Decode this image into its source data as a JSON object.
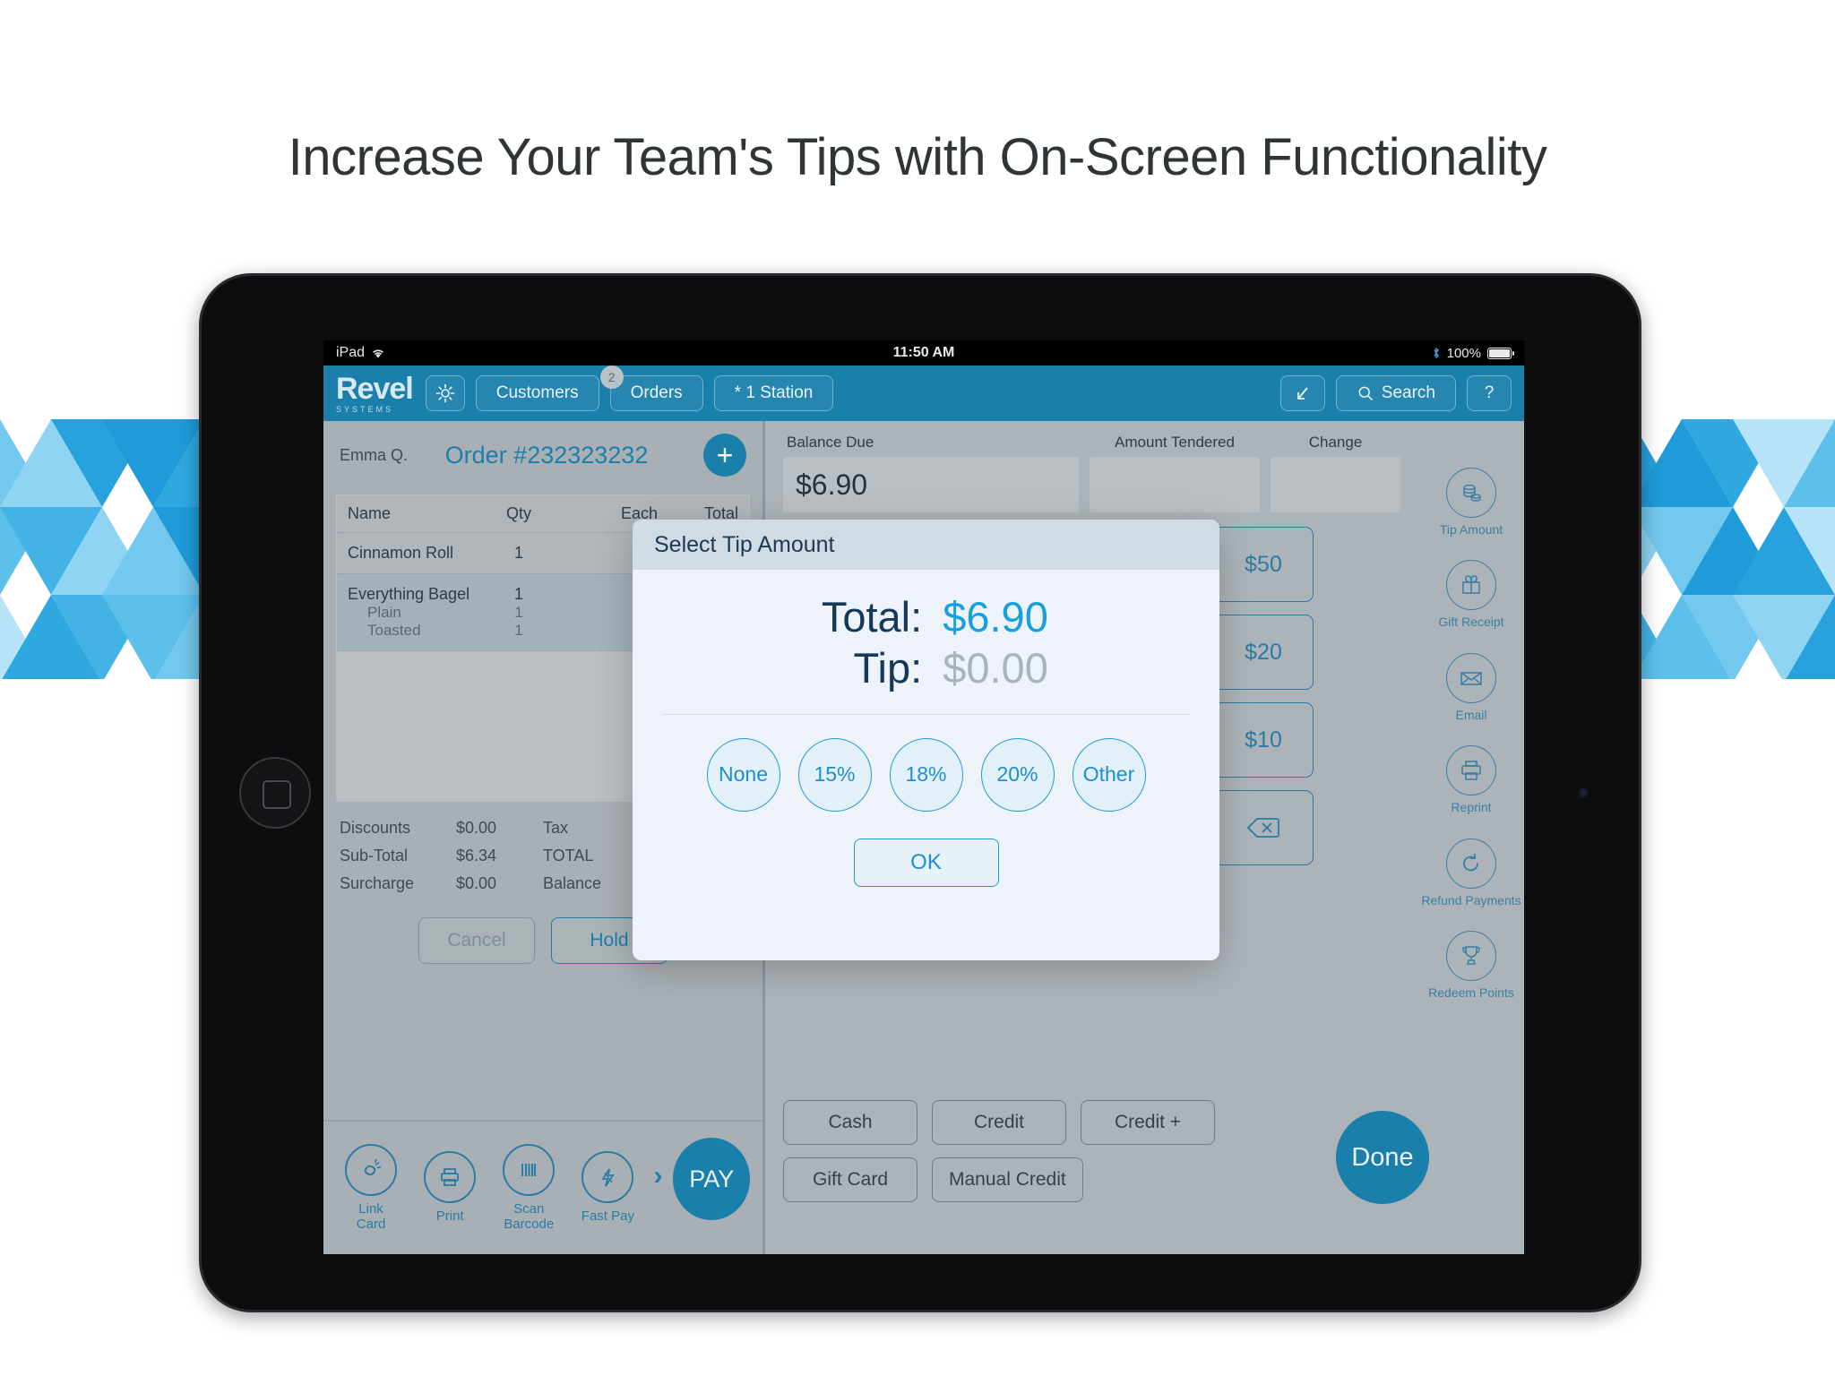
{
  "headline": "Increase Your Team's Tips with On-Screen Functionality",
  "status_bar": {
    "device": "iPad",
    "wifi_icon": "wifi-icon",
    "time": "11:50 AM",
    "bluetooth_icon": "bluetooth-icon",
    "battery_pct": "100%"
  },
  "toolbar": {
    "brand_name": "Revel",
    "brand_sub": "SYSTEMS",
    "settings_icon": "gear-icon",
    "customers_label": "Customers",
    "orders_label": "Orders",
    "orders_badge": "2",
    "station_label": "* 1 Station",
    "expand_icon": "expand-arrow-icon",
    "search_label": "Search",
    "search_icon": "search-icon",
    "help_label": "?"
  },
  "order": {
    "cashier": "Emma Q.",
    "order_number": "Order #232323232",
    "add_label": "+",
    "columns": [
      "Name",
      "Qty",
      "Each",
      "Total"
    ],
    "items": [
      {
        "name": "Cinnamon Roll",
        "qty": "1",
        "each": "",
        "total": ""
      },
      {
        "name": "Everything Bagel",
        "qty": "1",
        "each": "",
        "total": ""
      }
    ],
    "modifiers": [
      {
        "name": "Plain",
        "qty": "1"
      },
      {
        "name": "Toasted",
        "qty": "1"
      }
    ],
    "totals_left": [
      {
        "label": "Discounts",
        "value": "$0.00"
      },
      {
        "label": "Sub-Total",
        "value": "$6.34"
      },
      {
        "label": "Surcharge",
        "value": "$0.00"
      }
    ],
    "totals_right": [
      {
        "label": "Tax",
        "value": ""
      },
      {
        "label": "TOTAL",
        "value": ""
      },
      {
        "label": "Balance",
        "value": ""
      }
    ],
    "cancel_label": "Cancel",
    "hold_label": "Hold"
  },
  "quickbar": {
    "items": [
      {
        "icon": "link-card-icon",
        "label": "Link\nCard"
      },
      {
        "icon": "printer-icon",
        "label": "Print"
      },
      {
        "icon": "barcode-icon",
        "label": "Scan\nBarcode"
      },
      {
        "icon": "lightning-icon",
        "label": "Fast Pay"
      }
    ],
    "more_icon": "chevron-right-icon",
    "pay_label": "PAY"
  },
  "payment": {
    "balance_due_label": "Balance Due",
    "balance_due_value": "$6.90",
    "amount_tendered_label": "Amount Tendered",
    "amount_tendered_value": "",
    "change_label": "Change",
    "change_value": "",
    "denominations": [
      "$50",
      "$20",
      "$10"
    ],
    "backspace_icon": "backspace-icon",
    "methods_row1": [
      "Cash",
      "Credit",
      "Credit +"
    ],
    "methods_row2": [
      "Gift Card",
      "Manual Credit"
    ],
    "done_label": "Done"
  },
  "rail": {
    "items": [
      {
        "icon": "coins-icon",
        "label": "Tip Amount"
      },
      {
        "icon": "gift-icon",
        "label": "Gift Receipt"
      },
      {
        "icon": "envelope-icon",
        "label": "Email"
      },
      {
        "icon": "printer-icon",
        "label": "Reprint"
      },
      {
        "icon": "undo-icon",
        "label": "Refund Payments"
      },
      {
        "icon": "trophy-icon",
        "label": "Redeem Points"
      }
    ]
  },
  "modal": {
    "title": "Select Tip Amount",
    "total_label": "Total:",
    "total_value": "$6.90",
    "tip_label": "Tip:",
    "tip_value": "$0.00",
    "tip_options": [
      "None",
      "15%",
      "18%",
      "20%",
      "Other"
    ],
    "ok_label": "OK"
  },
  "colors": {
    "brand_blue": "#1a7fab",
    "accent_cyan": "#16a1de",
    "panel_gray": "#a9b0b5",
    "modal_bg": "#eef3f9",
    "modal_header": "#cfdce3"
  }
}
